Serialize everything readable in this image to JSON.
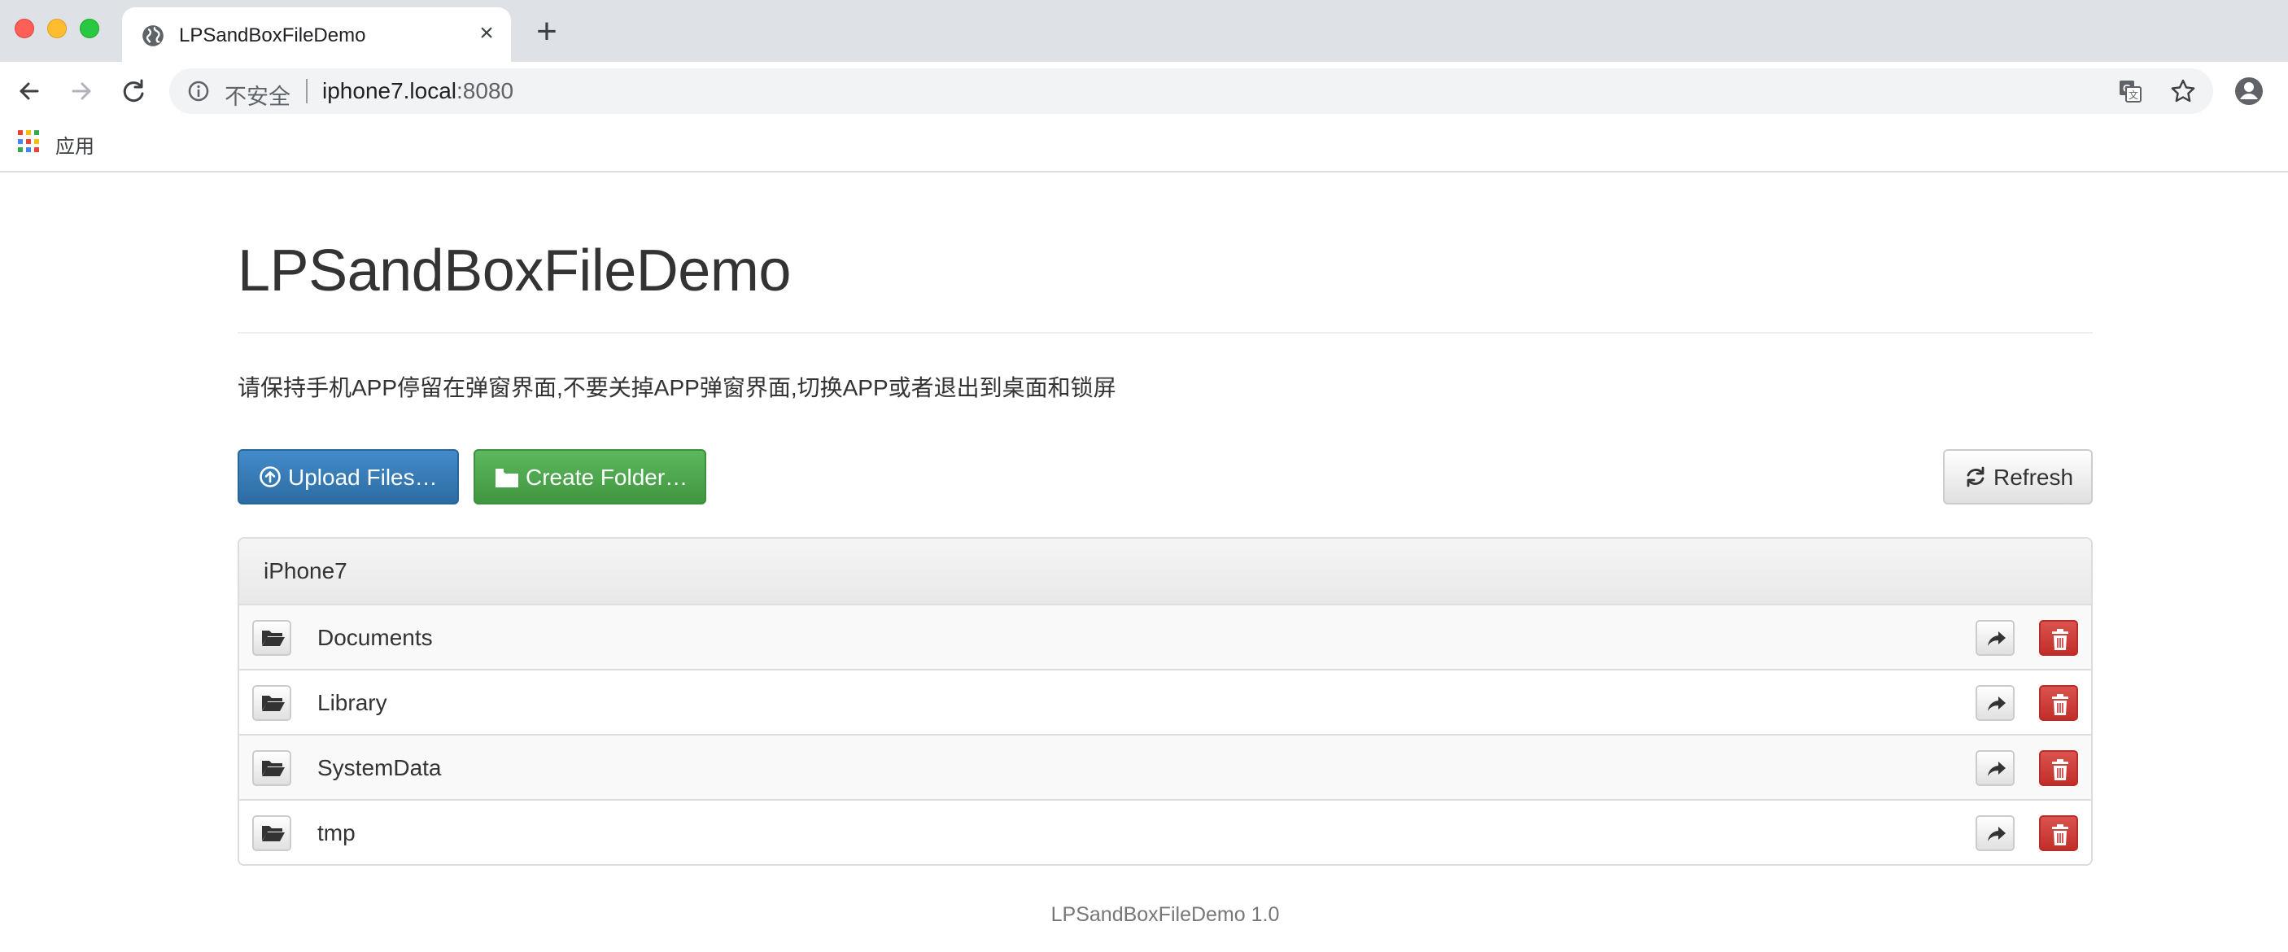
{
  "browser": {
    "tab": {
      "title": "LPSandBoxFileDemo",
      "favicon": "globe-icon",
      "close": "×"
    },
    "new_tab": "+",
    "address": {
      "security_label": "不安全",
      "host": "iphone7.local",
      "port": ":8080"
    },
    "bookmarks": {
      "apps_label": "应用"
    }
  },
  "page": {
    "title": "LPSandBoxFileDemo",
    "notice": "请保持手机APP停留在弹窗界面,不要关掉APP弹窗界面,切换APP或者退出到桌面和锁屏",
    "buttons": {
      "upload": "Upload Files…",
      "create_folder": "Create Folder…",
      "refresh": "Refresh"
    },
    "panel": {
      "heading": "iPhone7",
      "items": [
        {
          "name": "Documents"
        },
        {
          "name": "Library"
        },
        {
          "name": "SystemData"
        },
        {
          "name": "tmp"
        }
      ]
    },
    "footer": "LPSandBoxFileDemo 1.0"
  },
  "colors": {
    "primary": "#428bca",
    "success": "#5cb85c",
    "danger": "#d9534f",
    "chrome_tabstrip": "#dee1e6"
  }
}
